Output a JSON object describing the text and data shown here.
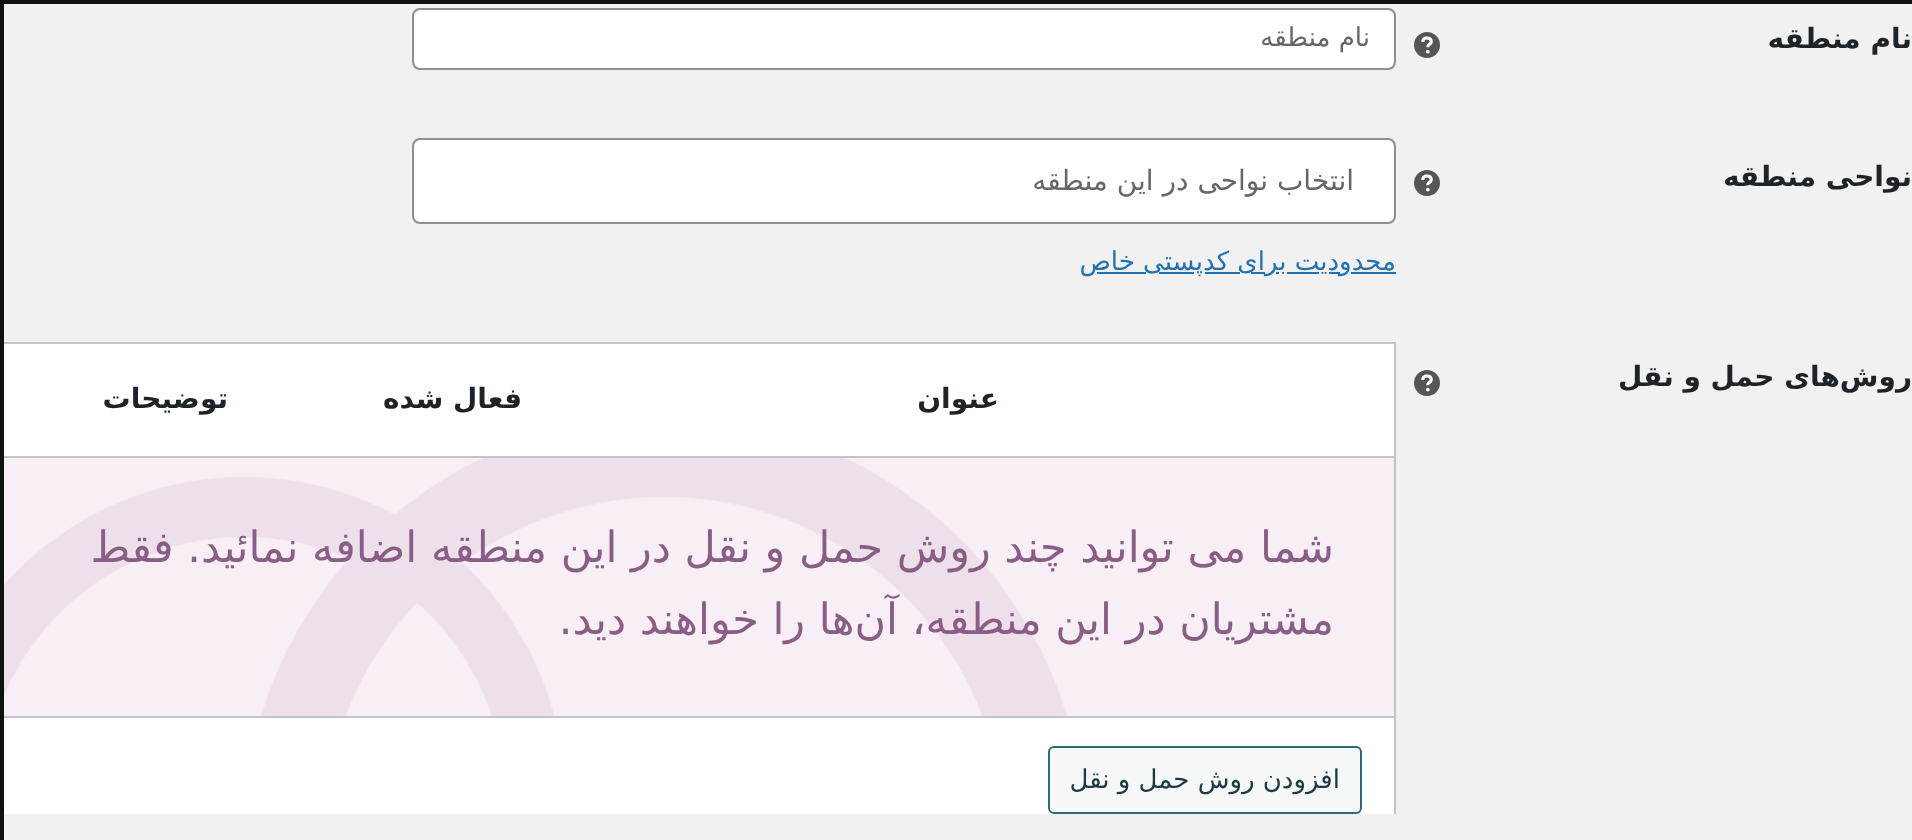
{
  "fields": [
    {
      "label": "نام منطقه",
      "placeholder": "نام منطقه",
      "kind": "short"
    },
    {
      "label": "نواحی منطقه",
      "placeholder": "انتخاب نواحی در این منطقه",
      "kind": "tall",
      "link": "محدودیت برای کدپستی خاص"
    }
  ],
  "shipping_methods": {
    "label": "روش‌های حمل و نقل",
    "table": {
      "columns": [
        "عنوان",
        "فعال شده",
        "توضیحات"
      ],
      "empty_message": "شما می توانید چند روش حمل و نقل در این منطقه اضافه نمائید. فقط مشتریان در این منطقه، آن‌ها را خواهند دید.",
      "button": "افزودن روش حمل و نقل"
    }
  }
}
